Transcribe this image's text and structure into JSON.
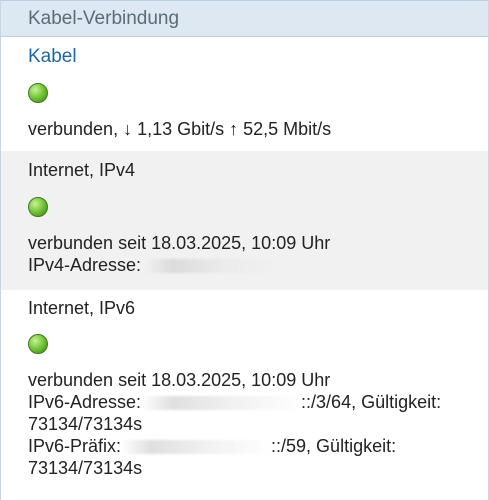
{
  "header": {
    "title": "Kabel-Verbindung"
  },
  "kabel": {
    "title": "Kabel",
    "status_led_color": "#78c83c",
    "status": "verbunden, ↓ 1,13 Gbit/s ↑ 52,5 Mbit/s"
  },
  "ipv4": {
    "title": "Internet, IPv4",
    "status_led_color": "#78c83c",
    "connected_since": "verbunden seit 18.03.2025, 10:09 Uhr",
    "address_label": "IPv4-Adresse:"
  },
  "ipv6": {
    "title": "Internet, IPv6",
    "status_led_color": "#78c83c",
    "connected_since": "verbunden seit 18.03.2025, 10:09 Uhr",
    "address_label": "IPv6-Adresse:",
    "address_suffix": "::/3/64, Gültigkeit:",
    "address_validity": "73134/73134s",
    "prefix_label": "IPv6-Präfix:",
    "prefix_suffix": "::/59, Gültigkeit:",
    "prefix_validity": "73134/73134s"
  }
}
